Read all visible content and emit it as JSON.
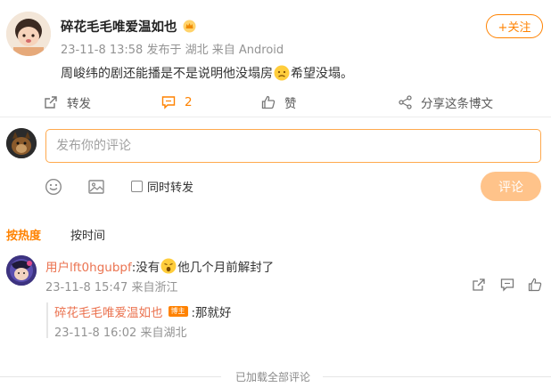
{
  "post": {
    "author": "碎花毛毛唯爱温如也",
    "date": "23-11-8 13:58",
    "location": "发布于 湖北",
    "source": "来自 Android",
    "follow_label": "+关注",
    "text_part1": "周峻纬的剧还能播是不是说明他没塌房",
    "text_part2": "希望没塌。",
    "emoji_name": "sad-face-emoji"
  },
  "actions": {
    "forward_label": "转发",
    "comment_count": "2",
    "like_label": "赞",
    "share_label": "分享这条博文"
  },
  "composer": {
    "placeholder": "发布你的评论",
    "forward_also_label": "同时转发",
    "submit_label": "评论"
  },
  "sort_tabs": {
    "hot": "按热度",
    "time": "按时间"
  },
  "comments": [
    {
      "user": "用户lft0hgubpf",
      "text_part1": ":没有",
      "text_part2": "他几个月前解封了",
      "emoji_name": "surprised-face-emoji",
      "date": "23-11-8 15:47",
      "location": "来自浙江",
      "reply": {
        "user": "碎花毛毛唯爱温如也",
        "badge": "博主",
        "text": ":那就好",
        "date": "23-11-8 16:02",
        "location": "来自湖北"
      }
    }
  ],
  "footer": {
    "loaded_all": "已加载全部评论"
  },
  "colors": {
    "accent": "#ff8200",
    "username": "#eb7350",
    "submit_disabled": "#ffc38a"
  }
}
